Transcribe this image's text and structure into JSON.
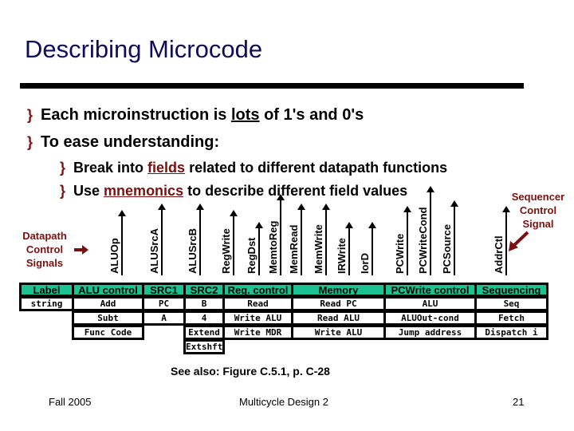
{
  "title": "Describing Microcode",
  "bullets": [
    {
      "pre": "Each microinstruction is ",
      "u": "lots",
      "post": " of 1's and 0's"
    },
    {
      "text": "To ease understanding:"
    }
  ],
  "subbullets": [
    {
      "pre": "Break into ",
      "u": "fields",
      "post": " related to different datapath functions"
    },
    {
      "pre": "Use ",
      "u": "mnemonics",
      "post": " to describe different field values"
    }
  ],
  "bullet_icon": "wingdings-bullet",
  "datapath_label": [
    "Datapath",
    "Control",
    "Signals"
  ],
  "sequencer_label": [
    "Sequencer",
    "Control",
    "Signal"
  ],
  "signals": [
    "ALUOp",
    "ALUSrcA",
    "ALUSrcB",
    "RegWrite",
    "RegDst",
    "MemtoReg",
    "MemRead",
    "MemWrite",
    "IRWrite",
    "IorD",
    "PCWrite",
    "PCWriteCond",
    "PCSource",
    "AddrCtl"
  ],
  "table": {
    "headers": [
      "Label",
      "ALU control",
      "SRC1",
      "SRC2",
      "Reg. control",
      "Memory",
      "PCWrite control",
      "Sequencing"
    ],
    "columns": [
      [
        "string"
      ],
      [
        "Add",
        "Subt",
        "Func Code"
      ],
      [
        "PC",
        "A"
      ],
      [
        "B",
        "4",
        "Extend",
        "Extshft"
      ],
      [
        "Read",
        "Write ALU",
        "Write MDR"
      ],
      [
        "Read PC",
        "Read ALU",
        "Write ALU"
      ],
      [
        "ALU",
        "ALUOut-cond",
        "Jump address"
      ],
      [
        "Seq",
        "Fetch",
        "Dispatch i"
      ]
    ],
    "header_color": "#1ac391"
  },
  "see_also": "See also: Figure C.5.1, p. C-28",
  "footer": {
    "left": "Fall 2005",
    "center": "Multicycle Design 2",
    "right": "21"
  },
  "accent_color": "#7a1010"
}
